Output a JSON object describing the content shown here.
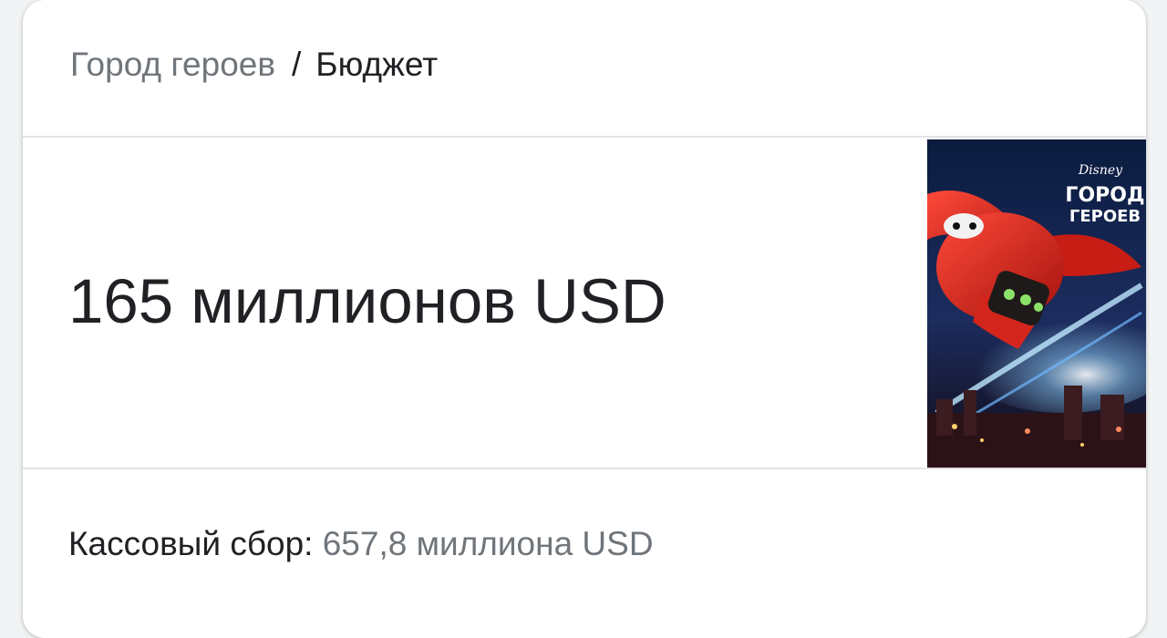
{
  "breadcrumb": {
    "parent": "Город героев",
    "separator": "/",
    "current": "Бюджет"
  },
  "answer": {
    "budget": "165 миллионов USD"
  },
  "poster": {
    "brand": "Disney",
    "title_line1": "ГОРОД",
    "title_line2": "ГЕРОЕВ"
  },
  "box_office": {
    "label": "Кассовый сбор:",
    "value": "657,8 миллиона USD"
  },
  "colors": {
    "primary_text": "#202124",
    "secondary_text": "#70757a",
    "divider": "#e3e4e6"
  }
}
